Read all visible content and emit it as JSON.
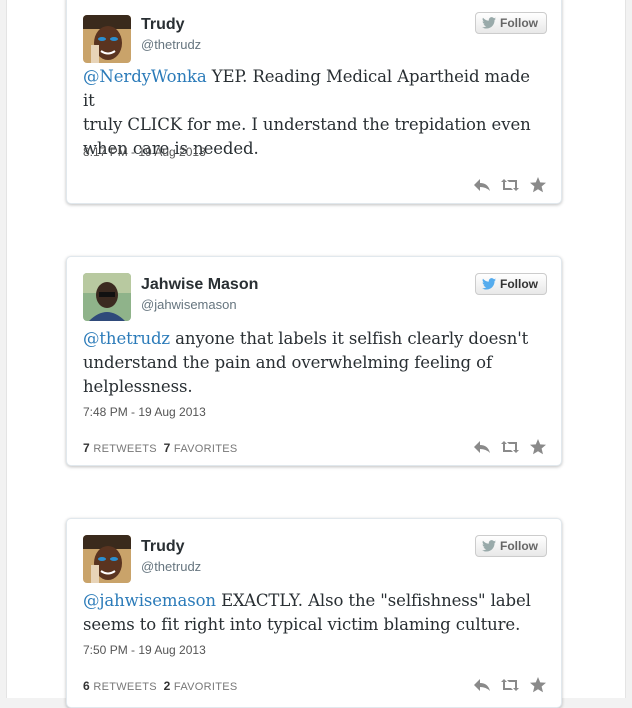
{
  "tweets": [
    {
      "name": "Trudy",
      "handle": "@thetrudz",
      "follow_label": "Follow",
      "mention": "@NerdyWonka",
      "text_line1_rest": " YEP. Reading Medical Apartheid made it",
      "text_line2": "truly CLICK for me. I understand the trepidation even",
      "text_line3": "when care is needed.",
      "timestamp": "8:17 PM - 19 Aug 2013"
    },
    {
      "name": "Jahwise Mason",
      "handle": "@jahwisemason",
      "follow_label": "Follow",
      "mention": "@thetrudz",
      "text_line1_rest": " anyone that labels it selfish clearly doesn't",
      "text_line2": "understand the pain and overwhelming feeling of",
      "text_line3": "helplessness.",
      "timestamp": "7:48 PM - 19 Aug 2013",
      "retweets": "7",
      "retweets_label": "RETWEETS",
      "favorites": "7",
      "favorites_label": "FAVORITES"
    },
    {
      "name": "Trudy",
      "handle": "@thetrudz",
      "follow_label": "Follow",
      "mention": "@jahwisemason",
      "text_line1_rest": " EXACTLY. Also the \"selfishness\" label",
      "text_line2": "seems to fit right into typical victim blaming culture.",
      "timestamp": "7:50 PM - 19 Aug 2013",
      "retweets": "6",
      "retweets_label": "RETWEETS",
      "favorites": "2",
      "favorites_label": "FAVORITES"
    }
  ],
  "icons": [
    "reply-icon",
    "retweet-icon",
    "favorite-icon",
    "twitter-bird-icon"
  ],
  "colors": {
    "link": "#2b7bb9",
    "bird": "#55acee"
  }
}
